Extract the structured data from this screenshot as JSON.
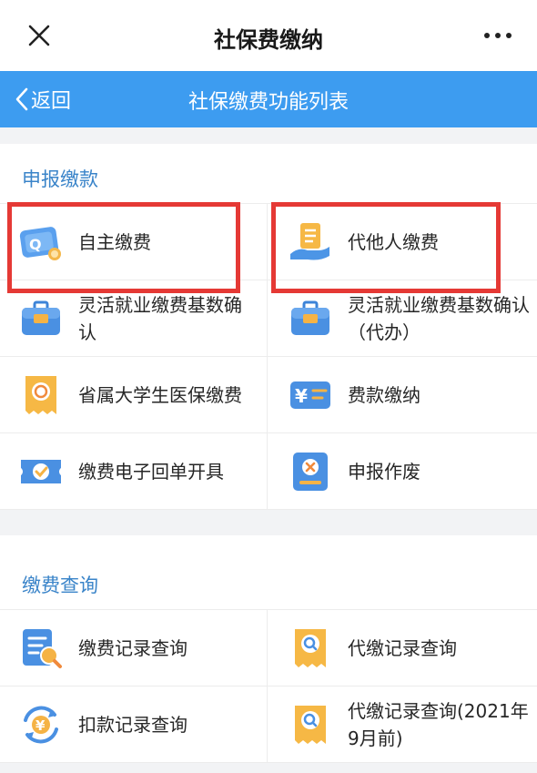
{
  "topbar": {
    "title": "社保费缴纳",
    "close_icon": "close-icon",
    "more_icon": "more-icon"
  },
  "navbar": {
    "back_label": "返回",
    "title": "社保缴费功能列表",
    "color": "#3d9cf0"
  },
  "section1": {
    "heading": "申报缴款",
    "items": [
      {
        "label": "自主缴费",
        "icon": "card-pay-icon",
        "highlighted": true
      },
      {
        "label": "代他人缴费",
        "icon": "receipt-hand-icon",
        "highlighted": true
      },
      {
        "label": "灵活就业缴费基数确认",
        "icon": "briefcase-icon"
      },
      {
        "label": "灵活就业缴费基数确认（代办）",
        "icon": "briefcase-icon"
      },
      {
        "label": "省属大学生医保缴费",
        "icon": "medical-ticket-icon"
      },
      {
        "label": "费款缴纳",
        "icon": "yuan-card-icon"
      },
      {
        "label": "缴费电子回单开具",
        "icon": "ticket-check-icon"
      },
      {
        "label": "申报作废",
        "icon": "void-doc-icon"
      }
    ]
  },
  "section2": {
    "heading": "缴费查询",
    "items": [
      {
        "label": "缴费记录查询",
        "icon": "record-search-icon"
      },
      {
        "label": "代缴记录查询",
        "icon": "receipt-search-icon"
      },
      {
        "label": "扣款记录查询",
        "icon": "yuan-refresh-icon"
      },
      {
        "label": "代缴记录查询(2021年9月前)",
        "icon": "receipt-search-icon"
      }
    ]
  },
  "highlight_color": "#e53935"
}
